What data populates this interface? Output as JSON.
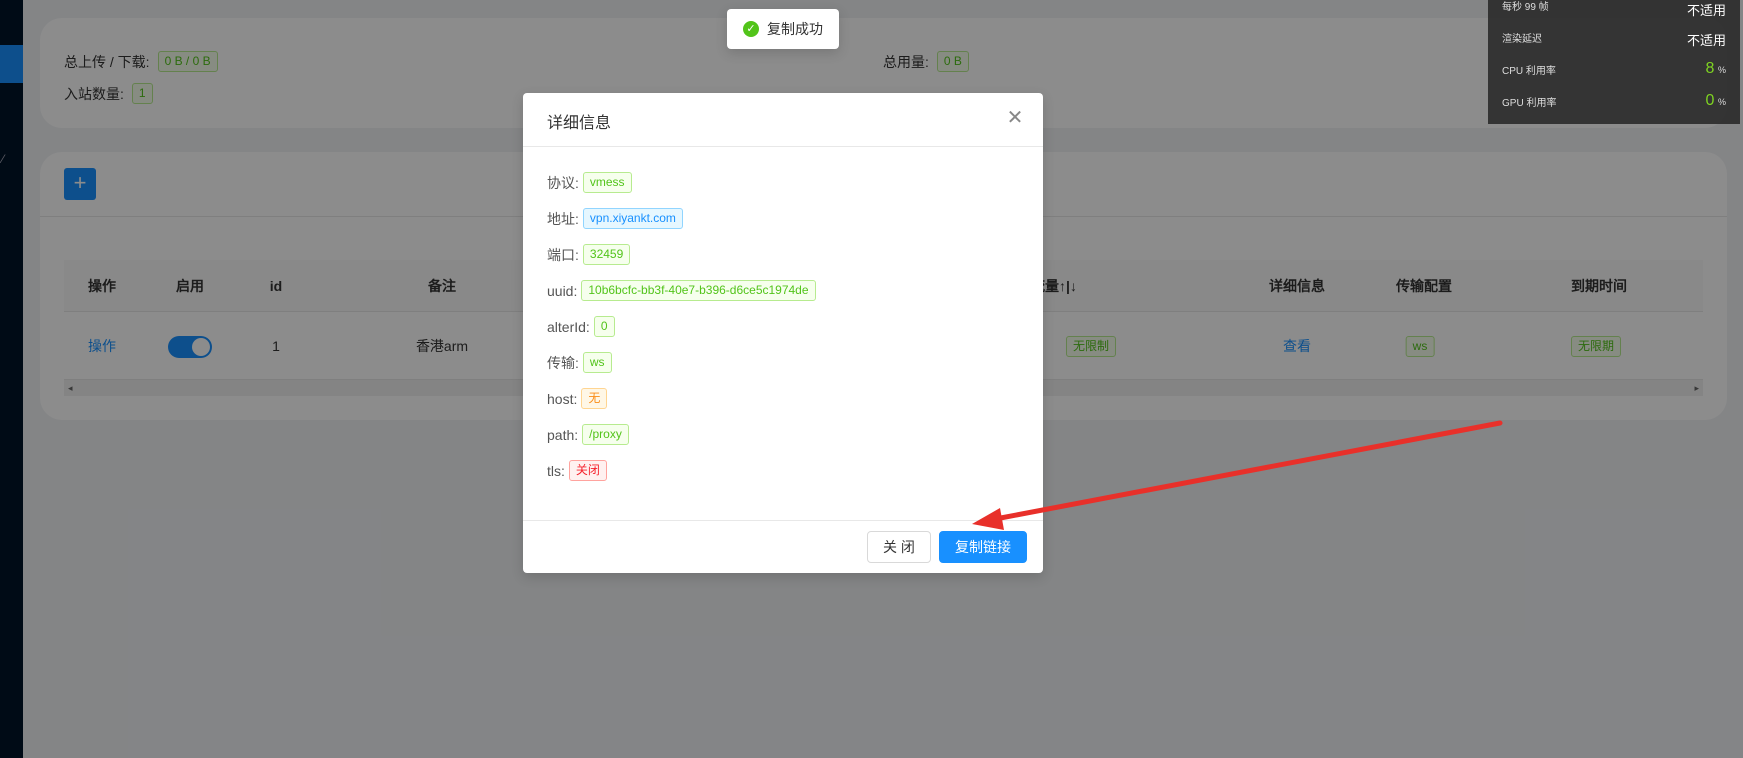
{
  "stats": {
    "upload_download_label": "总上传 / 下载:",
    "upload_download_value": "0 B / 0 B",
    "total_usage_label": "总用量:",
    "total_usage_value": "0 B",
    "inbound_count_label": "入站数量:",
    "inbound_count_value": "1"
  },
  "toolbar": {
    "add_label": "+"
  },
  "table": {
    "columns": [
      "操作",
      "启用",
      "id",
      "备注",
      "流量↑|↓",
      "详细信息",
      "传输配置",
      "到期时间"
    ],
    "row": {
      "action": "操作",
      "enabled": true,
      "id": "1",
      "remark": "香港arm",
      "traffic_tag": "无限制",
      "detail": "查看",
      "transport": "ws",
      "expiry": "无限期"
    },
    "scroll_left": "◂",
    "scroll_right": "▸"
  },
  "perf_overlay": {
    "fps_label": "每秒 99 帧",
    "render_delay_label": "渲染延迟",
    "render_delay_value": "不适用",
    "fps_value": "不适用",
    "cpu_label": "CPU 利用率",
    "cpu_value": "8",
    "gpu_label": "GPU 利用率",
    "gpu_value": "0",
    "unit": "%"
  },
  "toast": {
    "message": "复制成功"
  },
  "modal": {
    "title": "详细信息",
    "close_icon": "close-icon",
    "fields": [
      {
        "label": "协议:",
        "value": "vmess",
        "color": "green"
      },
      {
        "label": "地址:",
        "value": "vpn.xiyankt.com",
        "color": "blue"
      },
      {
        "label": "端口:",
        "value": "32459",
        "color": "green"
      },
      {
        "label": "uuid:",
        "value": "10b6bcfc-bb3f-40e7-b396-d6ce5c1974de",
        "color": "green"
      },
      {
        "label": "alterId:",
        "value": "0",
        "color": "green"
      },
      {
        "label": "传输:",
        "value": "ws",
        "color": "green"
      },
      {
        "label": "host:",
        "value": "无",
        "color": "orange"
      },
      {
        "label": "path:",
        "value": "/proxy",
        "color": "green"
      },
      {
        "label": "tls:",
        "value": "关闭",
        "color": "red"
      }
    ],
    "close_button": "关 闭",
    "copy_button": "复制链接"
  },
  "colors": {
    "primary": "#1890ff",
    "success": "#52c41a",
    "annotation_arrow": "#e8302a"
  }
}
